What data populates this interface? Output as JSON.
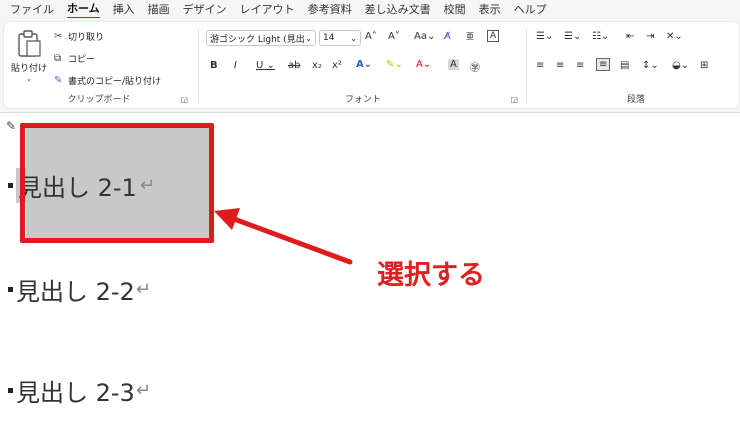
{
  "menu": [
    "ファイル",
    "ホーム",
    "挿入",
    "描画",
    "デザイン",
    "レイアウト",
    "参考資料",
    "差し込み文書",
    "校閲",
    "表示",
    "ヘルプ"
  ],
  "menu_active": "ホーム",
  "clipboard": {
    "paste": "貼り付け",
    "cut": "切り取り",
    "copy": "コピー",
    "format_painter": "書式のコピー/貼り付け",
    "group": "クリップボード"
  },
  "font": {
    "name": "游ゴシック Light (見出",
    "size": "14",
    "group": "フォント"
  },
  "paragraph": {
    "group": "段落"
  },
  "doc": {
    "lines": [
      {
        "text": "見出し 2-1",
        "mark": "↵"
      },
      {
        "text": "見出し 2-2",
        "mark": "↵"
      },
      {
        "text": "見出し 2-3",
        "mark": "↵"
      }
    ]
  },
  "annotation": {
    "text": "選択する",
    "color": "#e02020"
  }
}
